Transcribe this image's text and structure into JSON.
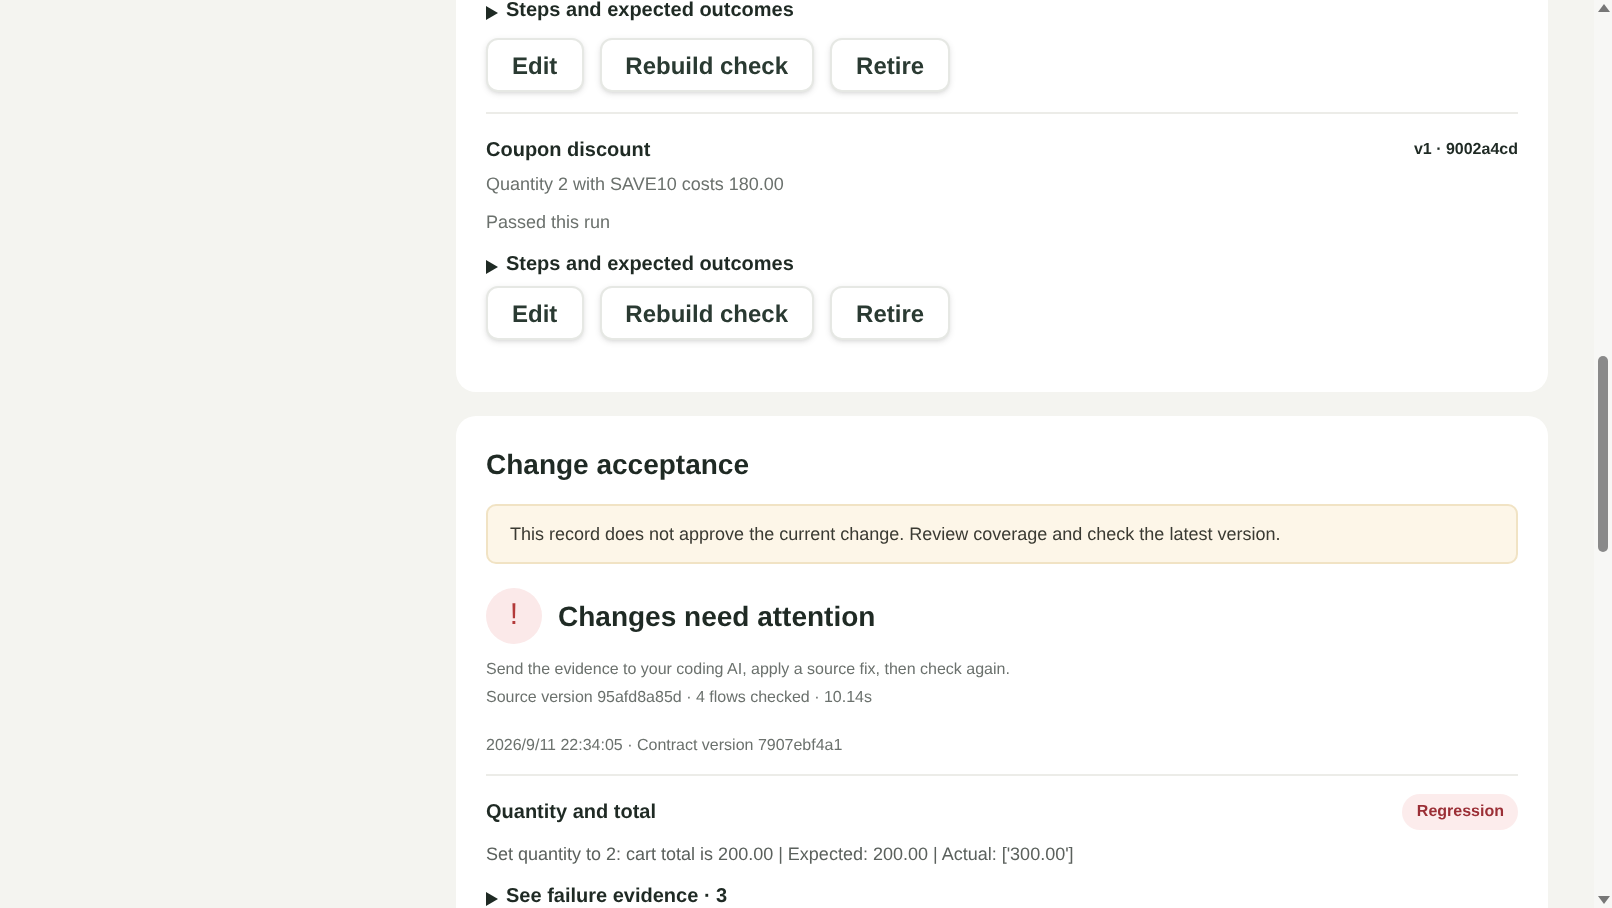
{
  "checks": [
    {
      "steps_label": "Steps and expected outcomes",
      "actions": [
        "Edit",
        "Rebuild check",
        "Retire"
      ]
    },
    {
      "title": "Coupon discount",
      "version": "v1 · 9002a4cd",
      "description": "Quantity 2 with SAVE10 costs 180.00",
      "result": "Passed this run",
      "steps_label": "Steps and expected outcomes",
      "actions": [
        "Edit",
        "Rebuild check",
        "Retire"
      ]
    }
  ],
  "change_acceptance": {
    "title": "Change acceptance",
    "notice": "This record does not approve the current change. Review coverage and check the latest version.",
    "status_icon": "!",
    "status": "Changes need attention",
    "advice": "Send the evidence to your coding AI, apply a source fix, then check again.",
    "source_line": "Source version 95afd8a85d · 4 flows checked · 10.14s",
    "date_line": "2026/9/11 22:34:05 · Contract version 7907ebf4a1",
    "failures": [
      {
        "title": "Quantity and total",
        "badge": "Regression",
        "detail": "Set quantity to 2: cart total is 200.00 | Expected: 200.00 | Actual: ['300.00']",
        "evidence_label": "See failure evidence · 3"
      }
    ]
  }
}
